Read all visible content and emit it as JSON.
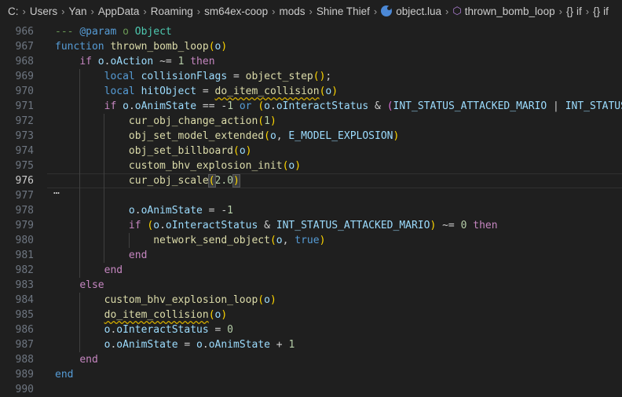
{
  "breadcrumb": {
    "path": [
      "C:",
      "Users",
      "Yan",
      "AppData",
      "Roaming",
      "sm64ex-coop",
      "mods",
      "Shine Thief"
    ],
    "file": "object.lua",
    "symbols": [
      "thrown_bomb_loop",
      "if",
      "if"
    ],
    "symbol_icons": [
      "cube-icon",
      "braces-icon",
      "braces-icon"
    ]
  },
  "editor": {
    "current_line": "976",
    "folded_marker": "…",
    "lines": [
      {
        "num": "966",
        "tokens": [
          {
            "t": "--- ",
            "c": "c"
          },
          {
            "t": "@param",
            "c": "ck"
          },
          {
            "t": " o ",
            "c": "c"
          },
          {
            "t": "Object",
            "c": "ct"
          }
        ]
      },
      {
        "num": "967",
        "tokens": [
          {
            "t": "function ",
            "c": "k"
          },
          {
            "t": "thrown_bomb_loop",
            "c": "fn"
          },
          {
            "t": "(",
            "c": "p1"
          },
          {
            "t": "o",
            "c": "v"
          },
          {
            "t": ")",
            "c": "p1"
          }
        ]
      },
      {
        "num": "968",
        "tokens": [
          {
            "t": "    "
          },
          {
            "t": "if ",
            "c": "kc"
          },
          {
            "t": "o",
            "c": "v"
          },
          {
            "t": "."
          },
          {
            "t": "oAction",
            "c": "v"
          },
          {
            "t": " ~= "
          },
          {
            "t": "1",
            "c": "n"
          },
          {
            "t": " then",
            "c": "kc"
          }
        ]
      },
      {
        "num": "969",
        "tokens": [
          {
            "t": "        "
          },
          {
            "t": "local ",
            "c": "kl"
          },
          {
            "t": "collisionFlags",
            "c": "v"
          },
          {
            "t": " = "
          },
          {
            "t": "object_step",
            "c": "fn"
          },
          {
            "t": "()",
            "c": "p1"
          },
          {
            "t": ";"
          }
        ]
      },
      {
        "num": "970",
        "tokens": [
          {
            "t": "        "
          },
          {
            "t": "local ",
            "c": "kl"
          },
          {
            "t": "hitObject",
            "c": "v"
          },
          {
            "t": " = "
          },
          {
            "t": "do_item_collision",
            "c": "fn sq"
          },
          {
            "t": "(",
            "c": "p1"
          },
          {
            "t": "o",
            "c": "v"
          },
          {
            "t": ")",
            "c": "p1"
          }
        ]
      },
      {
        "num": "971",
        "tokens": [
          {
            "t": "        "
          },
          {
            "t": "if ",
            "c": "kc"
          },
          {
            "t": "o",
            "c": "v"
          },
          {
            "t": "."
          },
          {
            "t": "oAnimState",
            "c": "v"
          },
          {
            "t": " == -"
          },
          {
            "t": "1",
            "c": "n"
          },
          {
            "t": " or ",
            "c": "k"
          },
          {
            "t": "(",
            "c": "p1"
          },
          {
            "t": "o",
            "c": "v"
          },
          {
            "t": "."
          },
          {
            "t": "oInteractStatus",
            "c": "v"
          },
          {
            "t": " & "
          },
          {
            "t": "(",
            "c": "p2"
          },
          {
            "t": "INT_STATUS_ATTACKED_MARIO",
            "c": "v"
          },
          {
            "t": " | "
          },
          {
            "t": "INT_STATUS_",
            "c": "v"
          }
        ]
      },
      {
        "num": "972",
        "tokens": [
          {
            "t": "            "
          },
          {
            "t": "cur_obj_change_action",
            "c": "fn"
          },
          {
            "t": "(",
            "c": "p1"
          },
          {
            "t": "1",
            "c": "n"
          },
          {
            "t": ")",
            "c": "p1"
          }
        ]
      },
      {
        "num": "973",
        "tokens": [
          {
            "t": "            "
          },
          {
            "t": "obj_set_model_extended",
            "c": "fn"
          },
          {
            "t": "(",
            "c": "p1"
          },
          {
            "t": "o",
            "c": "v"
          },
          {
            "t": ", "
          },
          {
            "t": "E_MODEL_EXPLOSION",
            "c": "v"
          },
          {
            "t": ")",
            "c": "p1"
          }
        ]
      },
      {
        "num": "974",
        "tokens": [
          {
            "t": "            "
          },
          {
            "t": "obj_set_billboard",
            "c": "fn"
          },
          {
            "t": "(",
            "c": "p1"
          },
          {
            "t": "o",
            "c": "v"
          },
          {
            "t": ")",
            "c": "p1"
          }
        ]
      },
      {
        "num": "975",
        "tokens": [
          {
            "t": "            "
          },
          {
            "t": "custom_bhv_explosion_init",
            "c": "fn"
          },
          {
            "t": "(",
            "c": "p1"
          },
          {
            "t": "o",
            "c": "v"
          },
          {
            "t": ")",
            "c": "p1"
          }
        ]
      },
      {
        "num": "976",
        "tokens": [
          {
            "t": "            "
          },
          {
            "t": "cur_obj_scale",
            "c": "fn"
          },
          {
            "t": "(",
            "c": "p1 sel"
          },
          {
            "t": "2.0",
            "c": "n"
          },
          {
            "t": ")",
            "c": "p1 sel"
          }
        ]
      },
      {
        "num": "977",
        "tokens": []
      },
      {
        "num": "978",
        "tokens": [
          {
            "t": "            "
          },
          {
            "t": "o",
            "c": "v"
          },
          {
            "t": "."
          },
          {
            "t": "oAnimState",
            "c": "v"
          },
          {
            "t": " = -"
          },
          {
            "t": "1",
            "c": "n"
          }
        ]
      },
      {
        "num": "979",
        "tokens": [
          {
            "t": "            "
          },
          {
            "t": "if ",
            "c": "kc"
          },
          {
            "t": "(",
            "c": "p1"
          },
          {
            "t": "o",
            "c": "v"
          },
          {
            "t": "."
          },
          {
            "t": "oInteractStatus",
            "c": "v"
          },
          {
            "t": " & "
          },
          {
            "t": "INT_STATUS_ATTACKED_MARIO",
            "c": "v"
          },
          {
            "t": ")",
            "c": "p1"
          },
          {
            "t": " ~= "
          },
          {
            "t": "0",
            "c": "n"
          },
          {
            "t": " then",
            "c": "kc"
          }
        ]
      },
      {
        "num": "980",
        "tokens": [
          {
            "t": "                "
          },
          {
            "t": "network_send_object",
            "c": "fn"
          },
          {
            "t": "(",
            "c": "p1"
          },
          {
            "t": "o",
            "c": "v"
          },
          {
            "t": ", "
          },
          {
            "t": "true",
            "c": "k"
          },
          {
            "t": ")",
            "c": "p1"
          }
        ]
      },
      {
        "num": "981",
        "tokens": [
          {
            "t": "            "
          },
          {
            "t": "end",
            "c": "kc"
          }
        ]
      },
      {
        "num": "982",
        "tokens": [
          {
            "t": "        "
          },
          {
            "t": "end",
            "c": "kc"
          }
        ]
      },
      {
        "num": "983",
        "tokens": [
          {
            "t": "    "
          },
          {
            "t": "else",
            "c": "kc"
          }
        ]
      },
      {
        "num": "984",
        "tokens": [
          {
            "t": "        "
          },
          {
            "t": "custom_bhv_explosion_loop",
            "c": "fn"
          },
          {
            "t": "(",
            "c": "p1"
          },
          {
            "t": "o",
            "c": "v"
          },
          {
            "t": ")",
            "c": "p1"
          }
        ]
      },
      {
        "num": "985",
        "tokens": [
          {
            "t": "        "
          },
          {
            "t": "do_item_collision",
            "c": "fn sq"
          },
          {
            "t": "(",
            "c": "p1"
          },
          {
            "t": "o",
            "c": "v"
          },
          {
            "t": ")",
            "c": "p1"
          }
        ]
      },
      {
        "num": "986",
        "tokens": [
          {
            "t": "        "
          },
          {
            "t": "o",
            "c": "v"
          },
          {
            "t": "."
          },
          {
            "t": "oInteractStatus",
            "c": "v"
          },
          {
            "t": " = "
          },
          {
            "t": "0",
            "c": "n"
          }
        ]
      },
      {
        "num": "987",
        "tokens": [
          {
            "t": "        "
          },
          {
            "t": "o",
            "c": "v"
          },
          {
            "t": "."
          },
          {
            "t": "oAnimState",
            "c": "v"
          },
          {
            "t": " = "
          },
          {
            "t": "o",
            "c": "v"
          },
          {
            "t": "."
          },
          {
            "t": "oAnimState",
            "c": "v"
          },
          {
            "t": " + "
          },
          {
            "t": "1",
            "c": "n"
          }
        ]
      },
      {
        "num": "988",
        "tokens": [
          {
            "t": "    "
          },
          {
            "t": "end",
            "c": "kc"
          }
        ]
      },
      {
        "num": "989",
        "tokens": [
          {
            "t": "end",
            "c": "k"
          }
        ]
      },
      {
        "num": "990",
        "tokens": []
      }
    ]
  }
}
